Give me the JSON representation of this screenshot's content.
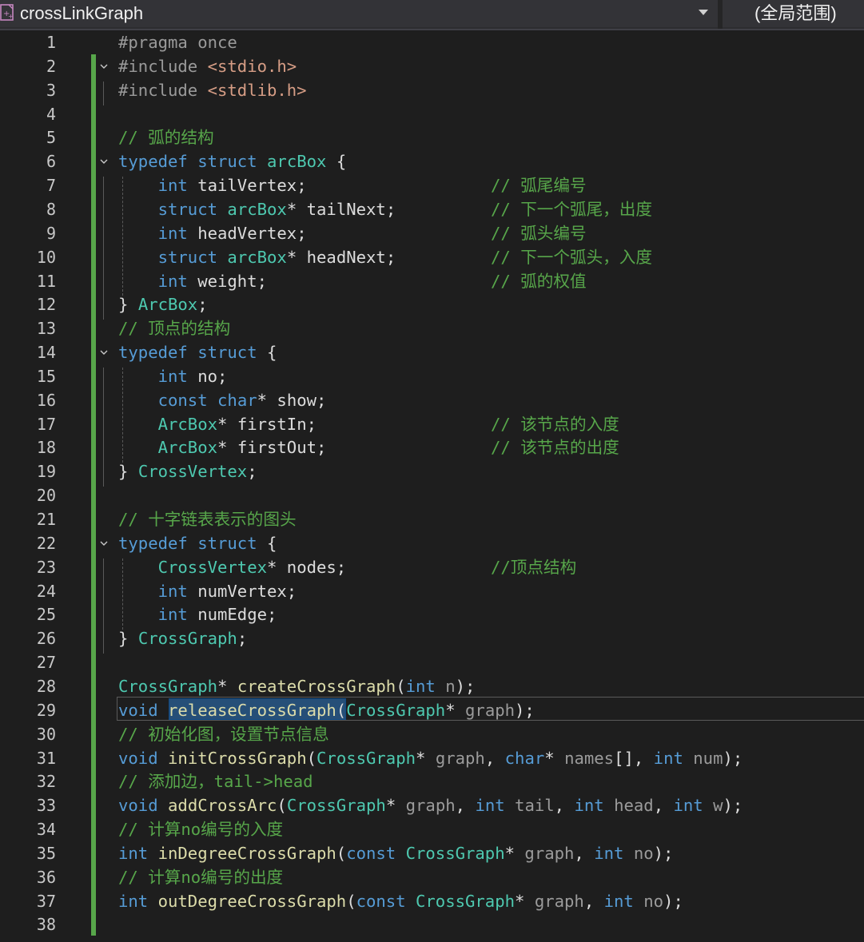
{
  "header": {
    "file_title": "crossLinkGraph",
    "scope_label": "(全局范围)"
  },
  "colors": {
    "background": "#1e1e1e",
    "keyword": "#569cd6",
    "type": "#4ec9b0",
    "comment": "#57a64a",
    "string": "#d69d85",
    "selection": "#264f78"
  },
  "lines": [
    {
      "n": "1",
      "tokens": [
        {
          "t": "#pragma once",
          "c": "pr"
        }
      ]
    },
    {
      "n": "2",
      "fold": true,
      "tokens": [
        {
          "t": "#include ",
          "c": "pr"
        },
        {
          "t": "<stdio.h>",
          "c": "str"
        }
      ]
    },
    {
      "n": "3",
      "tokens": [
        {
          "t": "#include ",
          "c": "pr"
        },
        {
          "t": "<stdlib.h>",
          "c": "str"
        }
      ]
    },
    {
      "n": "4",
      "tokens": []
    },
    {
      "n": "5",
      "tokens": [
        {
          "t": "// 弧的结构",
          "c": "cm"
        }
      ]
    },
    {
      "n": "6",
      "fold": true,
      "tokens": [
        {
          "t": "typedef",
          "c": "kw"
        },
        {
          "t": " "
        },
        {
          "t": "struct",
          "c": "kw"
        },
        {
          "t": " "
        },
        {
          "t": "arcBox",
          "c": "ty"
        },
        {
          "t": " {"
        }
      ]
    },
    {
      "n": "7",
      "tokens": [
        {
          "t": "    "
        },
        {
          "t": "int",
          "c": "kw"
        },
        {
          "t": " tailVertex;"
        }
      ],
      "comment": "// 弧尾编号"
    },
    {
      "n": "8",
      "tokens": [
        {
          "t": "    "
        },
        {
          "t": "struct",
          "c": "kw"
        },
        {
          "t": " "
        },
        {
          "t": "arcBox",
          "c": "ty"
        },
        {
          "t": "* tailNext;"
        }
      ],
      "comment": "// 下一个弧尾，出度"
    },
    {
      "n": "9",
      "tokens": [
        {
          "t": "    "
        },
        {
          "t": "int",
          "c": "kw"
        },
        {
          "t": " headVertex;"
        }
      ],
      "comment": "// 弧头编号"
    },
    {
      "n": "10",
      "tokens": [
        {
          "t": "    "
        },
        {
          "t": "struct",
          "c": "kw"
        },
        {
          "t": " "
        },
        {
          "t": "arcBox",
          "c": "ty"
        },
        {
          "t": "* headNext;"
        }
      ],
      "comment": "// 下一个弧头，入度"
    },
    {
      "n": "11",
      "tokens": [
        {
          "t": "    "
        },
        {
          "t": "int",
          "c": "kw"
        },
        {
          "t": " weight;"
        }
      ],
      "comment": "// 弧的权值"
    },
    {
      "n": "12",
      "tokens": [
        {
          "t": "} "
        },
        {
          "t": "ArcBox",
          "c": "ty"
        },
        {
          "t": ";"
        }
      ]
    },
    {
      "n": "13",
      "tokens": [
        {
          "t": "// 顶点的结构",
          "c": "cm"
        }
      ]
    },
    {
      "n": "14",
      "fold": true,
      "tokens": [
        {
          "t": "typedef",
          "c": "kw"
        },
        {
          "t": " "
        },
        {
          "t": "struct",
          "c": "kw"
        },
        {
          "t": " {"
        }
      ]
    },
    {
      "n": "15",
      "tokens": [
        {
          "t": "    "
        },
        {
          "t": "int",
          "c": "kw"
        },
        {
          "t": " no;"
        }
      ]
    },
    {
      "n": "16",
      "tokens": [
        {
          "t": "    "
        },
        {
          "t": "const",
          "c": "kw"
        },
        {
          "t": " "
        },
        {
          "t": "char",
          "c": "kw"
        },
        {
          "t": "* show;"
        }
      ]
    },
    {
      "n": "17",
      "tokens": [
        {
          "t": "    "
        },
        {
          "t": "ArcBox",
          "c": "ty"
        },
        {
          "t": "* firstIn;"
        }
      ],
      "comment": "// 该节点的入度"
    },
    {
      "n": "18",
      "tokens": [
        {
          "t": "    "
        },
        {
          "t": "ArcBox",
          "c": "ty"
        },
        {
          "t": "* firstOut;"
        }
      ],
      "comment": "// 该节点的出度"
    },
    {
      "n": "19",
      "tokens": [
        {
          "t": "} "
        },
        {
          "t": "CrossVertex",
          "c": "ty"
        },
        {
          "t": ";"
        }
      ]
    },
    {
      "n": "20",
      "tokens": []
    },
    {
      "n": "21",
      "tokens": [
        {
          "t": "// 十字链表表示的图头",
          "c": "cm"
        }
      ]
    },
    {
      "n": "22",
      "fold": true,
      "tokens": [
        {
          "t": "typedef",
          "c": "kw"
        },
        {
          "t": " "
        },
        {
          "t": "struct",
          "c": "kw"
        },
        {
          "t": " {"
        }
      ]
    },
    {
      "n": "23",
      "tokens": [
        {
          "t": "    "
        },
        {
          "t": "CrossVertex",
          "c": "ty"
        },
        {
          "t": "* nodes;"
        }
      ],
      "comment": "//顶点结构"
    },
    {
      "n": "24",
      "tokens": [
        {
          "t": "    "
        },
        {
          "t": "int",
          "c": "kw"
        },
        {
          "t": " numVertex;"
        }
      ]
    },
    {
      "n": "25",
      "tokens": [
        {
          "t": "    "
        },
        {
          "t": "int",
          "c": "kw"
        },
        {
          "t": " numEdge;"
        }
      ]
    },
    {
      "n": "26",
      "tokens": [
        {
          "t": "} "
        },
        {
          "t": "CrossGraph",
          "c": "ty"
        },
        {
          "t": ";"
        }
      ]
    },
    {
      "n": "27",
      "tokens": []
    },
    {
      "n": "28",
      "tokens": [
        {
          "t": "CrossGraph",
          "c": "ty"
        },
        {
          "t": "* "
        },
        {
          "t": "createCrossGraph",
          "c": "fn"
        },
        {
          "t": "("
        },
        {
          "t": "int",
          "c": "kw"
        },
        {
          "t": " "
        },
        {
          "t": "n",
          "c": "gr"
        },
        {
          "t": ");"
        }
      ]
    },
    {
      "n": "29",
      "tokens": [
        {
          "t": "void",
          "c": "kw"
        },
        {
          "t": " "
        },
        {
          "t": "releaseCrossGraph",
          "c": "fn"
        },
        {
          "t": "("
        },
        {
          "t": "CrossGraph",
          "c": "ty"
        },
        {
          "t": "* "
        },
        {
          "t": "graph",
          "c": "gr"
        },
        {
          "t": ");"
        }
      ]
    },
    {
      "n": "30",
      "tokens": [
        {
          "t": "// 初始化图，设置节点信息",
          "c": "cm"
        }
      ]
    },
    {
      "n": "31",
      "tokens": [
        {
          "t": "void",
          "c": "kw"
        },
        {
          "t": " "
        },
        {
          "t": "initCrossGraph",
          "c": "fn"
        },
        {
          "t": "("
        },
        {
          "t": "CrossGraph",
          "c": "ty"
        },
        {
          "t": "* "
        },
        {
          "t": "graph",
          "c": "gr"
        },
        {
          "t": ", "
        },
        {
          "t": "char",
          "c": "kw"
        },
        {
          "t": "* "
        },
        {
          "t": "names",
          "c": "gr"
        },
        {
          "t": "[], "
        },
        {
          "t": "int",
          "c": "kw"
        },
        {
          "t": " "
        },
        {
          "t": "num",
          "c": "gr"
        },
        {
          "t": ");"
        }
      ]
    },
    {
      "n": "32",
      "tokens": [
        {
          "t": "// 添加边，tail->head",
          "c": "cm"
        }
      ]
    },
    {
      "n": "33",
      "tokens": [
        {
          "t": "void",
          "c": "kw"
        },
        {
          "t": " "
        },
        {
          "t": "addCrossArc",
          "c": "fn"
        },
        {
          "t": "("
        },
        {
          "t": "CrossGraph",
          "c": "ty"
        },
        {
          "t": "* "
        },
        {
          "t": "graph",
          "c": "gr"
        },
        {
          "t": ", "
        },
        {
          "t": "int",
          "c": "kw"
        },
        {
          "t": " "
        },
        {
          "t": "tail",
          "c": "gr"
        },
        {
          "t": ", "
        },
        {
          "t": "int",
          "c": "kw"
        },
        {
          "t": " "
        },
        {
          "t": "head",
          "c": "gr"
        },
        {
          "t": ", "
        },
        {
          "t": "int",
          "c": "kw"
        },
        {
          "t": " "
        },
        {
          "t": "w",
          "c": "gr"
        },
        {
          "t": ");"
        }
      ]
    },
    {
      "n": "34",
      "tokens": [
        {
          "t": "// 计算no编号的入度",
          "c": "cm"
        }
      ]
    },
    {
      "n": "35",
      "tokens": [
        {
          "t": "int",
          "c": "kw"
        },
        {
          "t": " "
        },
        {
          "t": "inDegreeCrossGraph",
          "c": "fn"
        },
        {
          "t": "("
        },
        {
          "t": "const",
          "c": "kw"
        },
        {
          "t": " "
        },
        {
          "t": "CrossGraph",
          "c": "ty"
        },
        {
          "t": "* "
        },
        {
          "t": "graph",
          "c": "gr"
        },
        {
          "t": ", "
        },
        {
          "t": "int",
          "c": "kw"
        },
        {
          "t": " "
        },
        {
          "t": "no",
          "c": "gr"
        },
        {
          "t": ");"
        }
      ]
    },
    {
      "n": "36",
      "tokens": [
        {
          "t": "// 计算no编号的出度",
          "c": "cm"
        }
      ]
    },
    {
      "n": "37",
      "tokens": [
        {
          "t": "int",
          "c": "kw"
        },
        {
          "t": " "
        },
        {
          "t": "outDegreeCrossGraph",
          "c": "fn"
        },
        {
          "t": "("
        },
        {
          "t": "const",
          "c": "kw"
        },
        {
          "t": " "
        },
        {
          "t": "CrossGraph",
          "c": "ty"
        },
        {
          "t": "* "
        },
        {
          "t": "graph",
          "c": "gr"
        },
        {
          "t": ", "
        },
        {
          "t": "int",
          "c": "kw"
        },
        {
          "t": " "
        },
        {
          "t": "no",
          "c": "gr"
        },
        {
          "t": ");"
        }
      ]
    },
    {
      "n": "38",
      "tokens": []
    }
  ]
}
